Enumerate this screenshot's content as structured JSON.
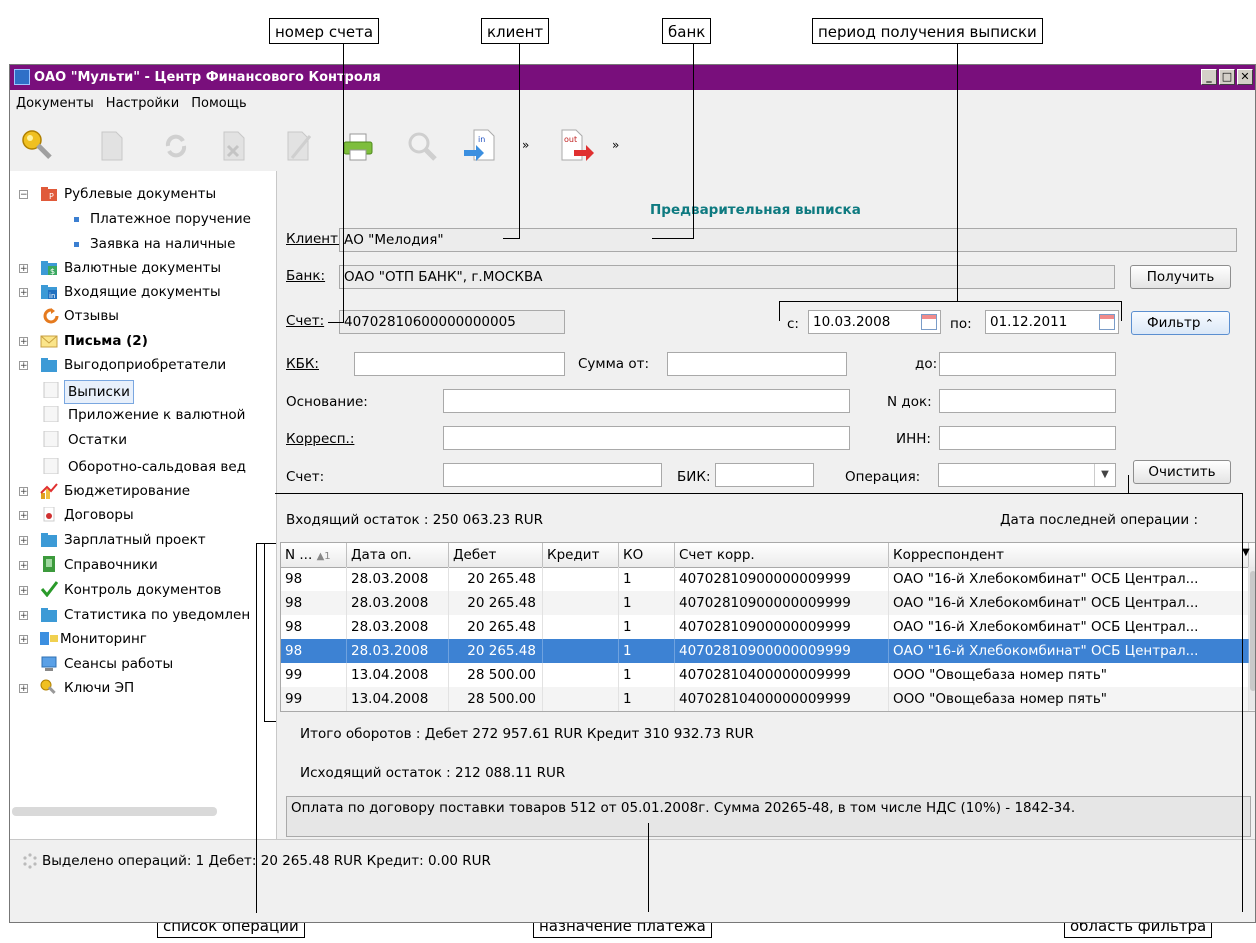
{
  "callouts": {
    "account_number": "номер счета",
    "client": "клиент",
    "bank": "банк",
    "period": "период получения выписки",
    "operations_list": "список операций",
    "payment_purpose": "назначение платежа",
    "filter_area": "область фильтра"
  },
  "window": {
    "title": "ОАО \"Мульти\" - Центр Финансового Контроля"
  },
  "menu": [
    "Документы",
    "Настройки",
    "Помощь"
  ],
  "tree": {
    "rub_docs": "Рублевые документы",
    "payment_order": "Платежное поручение",
    "cash_request": "Заявка на наличные",
    "currency_docs": "Валютные документы",
    "incoming_docs": "Входящие документы",
    "recalls": "Отзывы",
    "letters": "Письма (2)",
    "beneficiaries": "Выгодоприобретатели",
    "statements": "Выписки",
    "currency_appendix": "Приложение к валютной",
    "balances": "Остатки",
    "turnover": "Оборотно-сальдовая вед",
    "budgeting": "Бюджетирование",
    "contracts": "Договоры",
    "salary": "Зарплатный проект",
    "references": "Справочники",
    "doc_control": "Контроль документов",
    "notify_stats": "Статистика по уведомлен",
    "monitoring": "Мониторинг",
    "sessions": "Сеансы работы",
    "keys": "Ключи ЭП"
  },
  "form": {
    "heading": "Предварительная выписка",
    "client_label": "Клиент:",
    "client_value": "АО \"Мелодия\"",
    "bank_label": "Банк:",
    "bank_value": "ОАО \"ОТП БАНК\", г.МОСКВА",
    "get_button": "Получить",
    "account_label": "Счет:",
    "account_value": "40702810600000000005",
    "from_label": "с:",
    "from_value": "10.03.2008",
    "to_label": "по:",
    "to_value": "01.12.2011",
    "filter_button": "Фильтр",
    "kbk_label": "КБК:",
    "sum_from_label": "Сумма от:",
    "sum_to_label": "до:",
    "basis_label": "Основание:",
    "doc_no_label": "N док:",
    "corr_label": "Корресп.:",
    "inn_label": "ИНН:",
    "acc2_label": "Счет:",
    "bik_label": "БИК:",
    "operation_label": "Операция:",
    "clear_button": "Очистить",
    "incoming_balance": "Входящий остаток : 250 063.23  RUR",
    "last_op_date": "Дата последней операции :"
  },
  "grid": {
    "headers": [
      "N ...",
      "Дата оп.",
      "Дебет",
      "Кредит",
      "КО",
      "Счет корр.",
      "Корреспондент"
    ],
    "sort_mark": "▲1",
    "rows": [
      [
        "98",
        "28.03.2008",
        "20 265.48",
        "",
        "1",
        "40702810900000009999",
        "ОАО \"16-й Хлебокомбинат\" ОСБ Централ..."
      ],
      [
        "98",
        "28.03.2008",
        "20 265.48",
        "",
        "1",
        "40702810900000009999",
        "ОАО \"16-й Хлебокомбинат\" ОСБ Централ..."
      ],
      [
        "98",
        "28.03.2008",
        "20 265.48",
        "",
        "1",
        "40702810900000009999",
        "ОАО \"16-й Хлебокомбинат\" ОСБ Централ..."
      ],
      [
        "98",
        "28.03.2008",
        "20 265.48",
        "",
        "1",
        "40702810900000009999",
        "ОАО \"16-й Хлебокомбинат\" ОСБ Централ..."
      ],
      [
        "99",
        "13.04.2008",
        "28 500.00",
        "",
        "1",
        "40702810400000009999",
        "ООО \"Овощебаза номер пять\""
      ],
      [
        "99",
        "13.04.2008",
        "28 500.00",
        "",
        "1",
        "40702810400000009999",
        "ООО \"Овощебаза номер пять\""
      ]
    ],
    "selected_row": 3
  },
  "totals": {
    "turnover": "Итого оборотов : Дебет  272 957.61  RUR  Кредит  310 932.73  RUR",
    "outgoing": "Исходящий остаток : 212 088.11  RUR",
    "purpose": "Оплата по договору поставки товаров 512 от 05.01.2008г. Сумма 20265-48, в том числе НДС (10%) - 1842-34."
  },
  "status": {
    "text": "Выделено операций: 1 Дебет: 20 265.48 RUR Кредит: 0.00 RUR"
  }
}
